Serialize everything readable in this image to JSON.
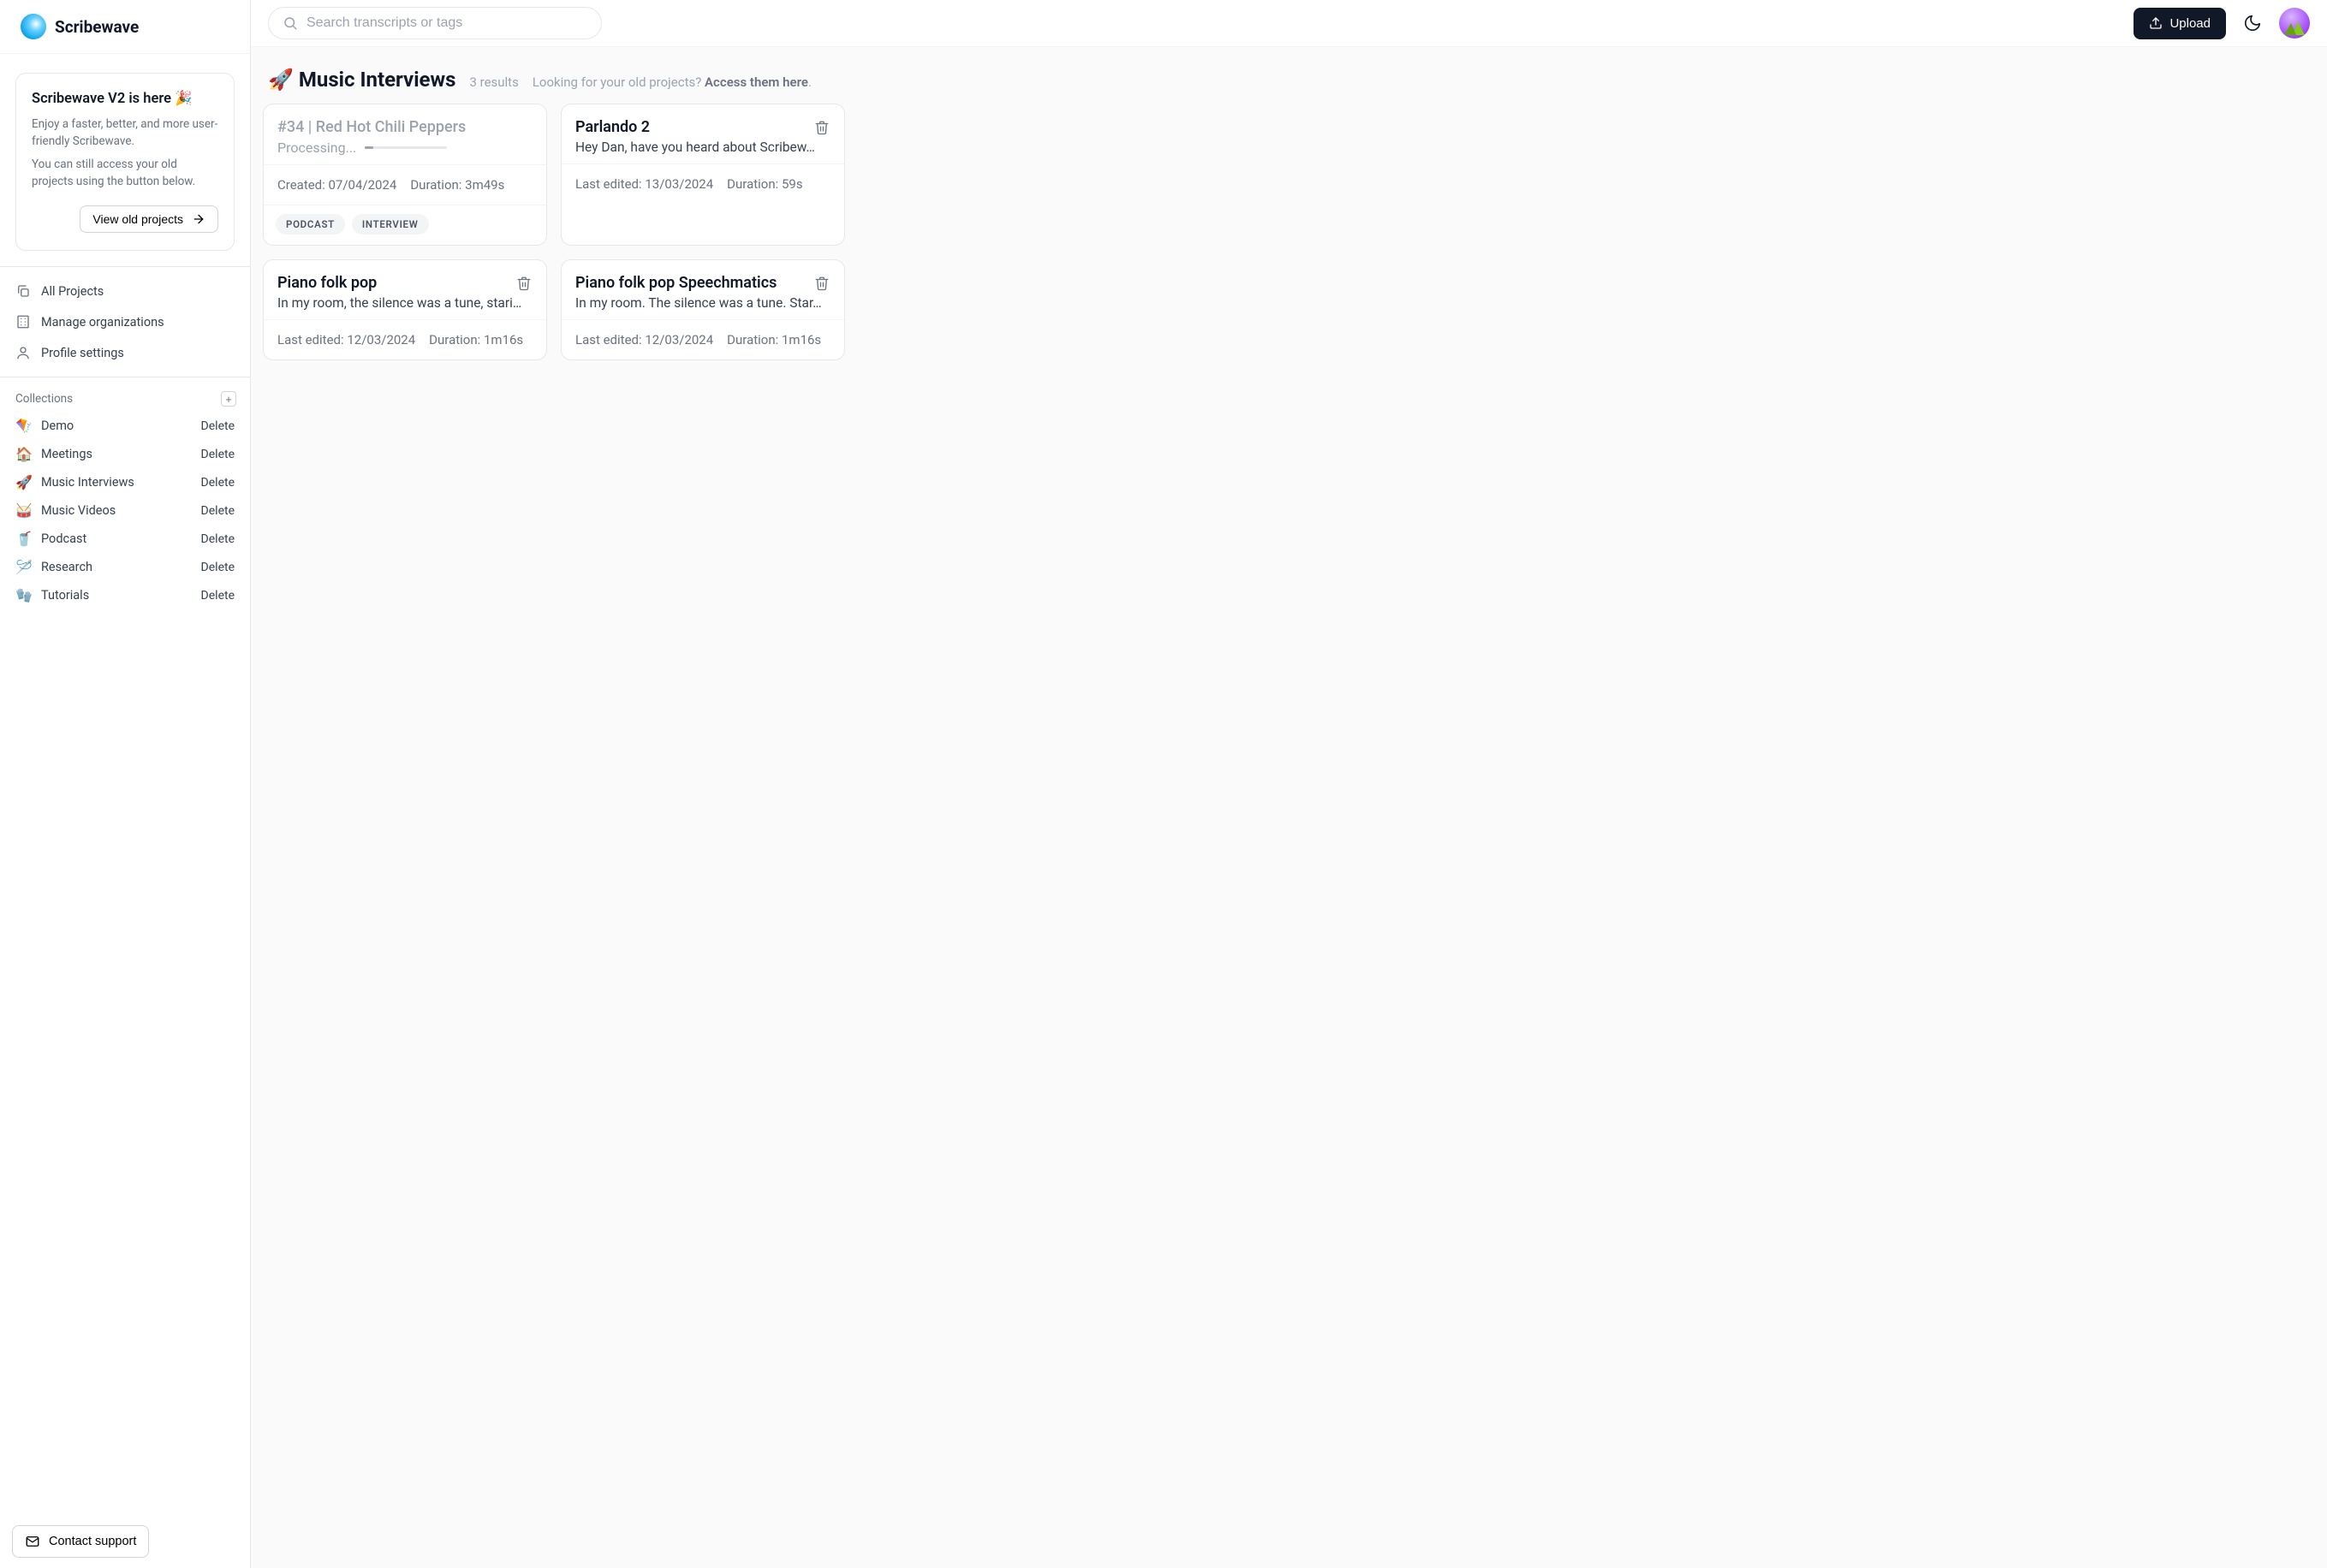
{
  "brand": {
    "name": "Scribewave"
  },
  "promo": {
    "title": "Scribewave V2 is here 🎉",
    "body1": "Enjoy a faster, better, and more user-friendly Scribewave.",
    "body2": "You can still access your old projects using the button below.",
    "cta": "View old projects"
  },
  "nav": {
    "all_projects": "All Projects",
    "manage_orgs": "Manage organizations",
    "profile": "Profile settings"
  },
  "collections_label": "Collections",
  "collections": [
    {
      "emoji": "🪁",
      "name": "Demo",
      "delete": "Delete"
    },
    {
      "emoji": "🏠",
      "name": "Meetings",
      "delete": "Delete"
    },
    {
      "emoji": "🚀",
      "name": "Music Interviews",
      "delete": "Delete"
    },
    {
      "emoji": "🥁",
      "name": "Music Videos",
      "delete": "Delete"
    },
    {
      "emoji": "🥤",
      "name": "Podcast",
      "delete": "Delete"
    },
    {
      "emoji": "🪡",
      "name": "Research",
      "delete": "Delete"
    },
    {
      "emoji": "🧤",
      "name": "Tutorials",
      "delete": "Delete"
    }
  ],
  "support_label": "Contact support",
  "search": {
    "placeholder": "Search transcripts or tags"
  },
  "upload_label": "Upload",
  "page": {
    "emoji": "🚀",
    "title": "Music Interviews",
    "results": "3 results",
    "old_prompt": "Looking for your old projects? ",
    "old_link": "Access them here",
    "period": "."
  },
  "cards": [
    {
      "title": "#34 | Red Hot Chili Peppers",
      "processing": true,
      "processing_label": "Processing...",
      "meta1_label": "Created: ",
      "meta1_value": "07/04/2024",
      "meta2_label": "Duration: ",
      "meta2_value": "3m49s",
      "tags": [
        "PODCAST",
        "INTERVIEW"
      ]
    },
    {
      "title": "Parlando 2",
      "sub": "Hey Dan, have you heard about Scribew…",
      "meta1_label": "Last edited: ",
      "meta1_value": "13/03/2024",
      "meta2_label": "Duration: ",
      "meta2_value": "59s"
    },
    {
      "title": "Piano folk pop",
      "sub": "In my room, the silence was a tune, stari…",
      "meta1_label": "Last edited: ",
      "meta1_value": "12/03/2024",
      "meta2_label": "Duration: ",
      "meta2_value": "1m16s"
    },
    {
      "title": "Piano folk pop Speechmatics",
      "sub": "In my room. The silence was a tune. Star…",
      "meta1_label": "Last edited: ",
      "meta1_value": "12/03/2024",
      "meta2_label": "Duration: ",
      "meta2_value": "1m16s"
    }
  ]
}
